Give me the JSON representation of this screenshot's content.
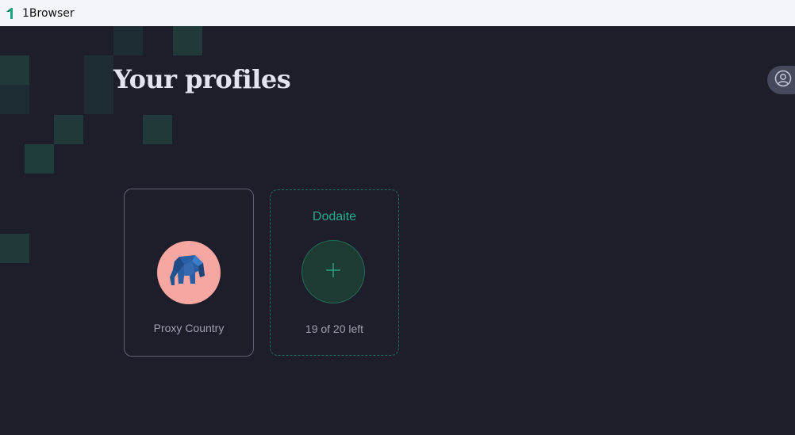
{
  "app": {
    "title": "1Browser"
  },
  "page": {
    "title": "Your profiles"
  },
  "profiles": [
    {
      "name": "Proxy Country",
      "avatar_color": "#f7a7a1",
      "avatar_icon": "blue-origami-elephant-icon"
    }
  ],
  "add_profile": {
    "title": "Dodaite",
    "remaining": "19 of 20 left"
  },
  "account": {
    "icon": "user-circle-icon"
  },
  "colors": {
    "background": "#1e1e2a",
    "accent": "#22ae8e",
    "titlebar": "#f3f5fb"
  }
}
